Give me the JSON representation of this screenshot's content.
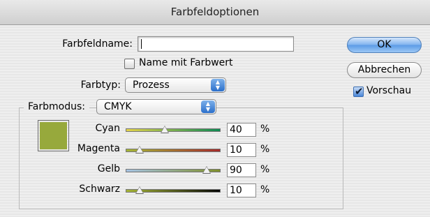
{
  "window": {
    "title": "Farbfeldoptionen"
  },
  "form": {
    "name_label": "Farbfeldname:",
    "name_value": "",
    "name_with_value_label": "Name mit Farbwert",
    "name_with_value_checked": false,
    "type_label": "Farbtyp:",
    "type_value": "Prozess",
    "mode_label": "Farbmodus:",
    "mode_value": "CMYK"
  },
  "buttons": {
    "ok": "OK",
    "cancel": "Abbrechen",
    "preview_label": "Vorschau",
    "preview_checked": true
  },
  "swatch": {
    "color": "#97a93c"
  },
  "sliders": [
    {
      "label": "Cyan",
      "value": "40",
      "unit": "%",
      "gradient": [
        "#e4d44a",
        "#0f8a54"
      ]
    },
    {
      "label": "Magenta",
      "value": "10",
      "unit": "%",
      "gradient": [
        "#a4b636",
        "#a42a2a"
      ]
    },
    {
      "label": "Gelb",
      "value": "90",
      "unit": "%",
      "gradient": [
        "#a6c4e4",
        "#7f8f2a"
      ]
    },
    {
      "label": "Schwarz",
      "value": "10",
      "unit": "%",
      "gradient": [
        "#a7b637",
        "#050505"
      ]
    }
  ]
}
